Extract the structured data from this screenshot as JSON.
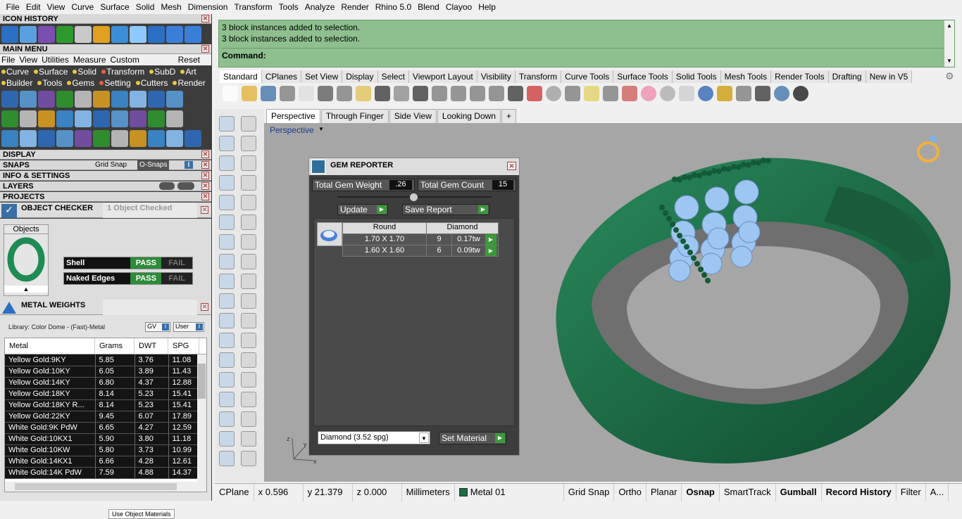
{
  "menu": [
    "File",
    "Edit",
    "View",
    "Curve",
    "Surface",
    "Solid",
    "Mesh",
    "Dimension",
    "Transform",
    "Tools",
    "Analyze",
    "Render",
    "Rhino 5.0",
    "Blend",
    "Clayoo",
    "Help"
  ],
  "left": {
    "icon_history": "ICON HISTORY",
    "main_menu": "MAIN MENU",
    "main_menu_items": [
      "File",
      "View",
      "Utilities",
      "Measure",
      "Custom"
    ],
    "reset": "Reset",
    "sub1": [
      "Curve",
      "Surface",
      "Solid",
      "Transform",
      "SubD",
      "Art"
    ],
    "sub2": [
      "Builder",
      "Tools",
      "Gems",
      "Setting",
      "Cutters",
      "Render"
    ],
    "display": "DISPLAY",
    "snaps": "SNAPS",
    "grid_snap": "Grid Snap",
    "osnaps": "O-Snaps",
    "info": "INFO & SETTINGS",
    "layers": "LAYERS",
    "projects": "PROJECTS",
    "object_checker": "OBJECT CHECKER",
    "objects_checked": "1  Object Checked",
    "objects_label": "Objects",
    "checks": [
      {
        "label": "Shell",
        "pass": "PASS",
        "fail": "FAIL"
      },
      {
        "label": "Naked Edges",
        "pass": "PASS",
        "fail": "FAIL"
      }
    ],
    "metal_weights": "METAL WEIGHTS",
    "library": "Library: Color Dome - (Fast)-Metal",
    "gv": "GV",
    "user": "User",
    "columns": [
      "Metal",
      "Grams",
      "DWT",
      "SPG"
    ],
    "rows": [
      [
        "Yellow Gold:9KY",
        "5.85",
        "3.76",
        "11.08"
      ],
      [
        "Yellow Gold:10KY",
        "6.05",
        "3.89",
        "11.43"
      ],
      [
        "Yellow Gold:14KY",
        "6.80",
        "4.37",
        "12.88"
      ],
      [
        "Yellow Gold:18KY",
        "8.14",
        "5.23",
        "15.41"
      ],
      [
        "Yellow Gold:18KY R...",
        "8.14",
        "5.23",
        "15.41"
      ],
      [
        "Yellow Gold:22KY",
        "9.45",
        "6.07",
        "17.89"
      ],
      [
        "White Gold:9K PdW",
        "6.65",
        "4.27",
        "12.59"
      ],
      [
        "White Gold:10KX1",
        "5.90",
        "3.80",
        "11.18"
      ],
      [
        "White Gold:10KW",
        "5.80",
        "3.73",
        "10.99"
      ],
      [
        "White Gold:14KX1",
        "6.66",
        "4.28",
        "12.61"
      ],
      [
        "White Gold:14K PdW",
        "7.59",
        "4.88",
        "14.37"
      ]
    ],
    "use_materials": "Use Object Materials"
  },
  "command": {
    "lines": [
      "3 block instances added to selection.",
      "3 block instances added to selection."
    ],
    "prompt": "Command:"
  },
  "tabs": [
    "Standard",
    "CPlanes",
    "Set View",
    "Display",
    "Select",
    "Viewport Layout",
    "Visibility",
    "Transform",
    "Curve Tools",
    "Surface Tools",
    "Solid Tools",
    "Mesh Tools",
    "Render Tools",
    "Drafting",
    "New in V5"
  ],
  "viewport_tabs": [
    "Perspective",
    "Through Finger",
    "Side View",
    "Looking Down",
    "+"
  ],
  "viewport_label": "Perspective",
  "gem_reporter": {
    "title": "GEM REPORTER",
    "weight_label": "Total Gem Weight",
    "weight": ".26",
    "count_label": "Total Gem Count",
    "count": "15",
    "update": "Update",
    "save": "Save Report",
    "shape": "Round",
    "material": "Diamond",
    "rows": [
      {
        "size": "1.70 X 1.70",
        "qty": "9",
        "tw": "0.17tw"
      },
      {
        "size": "1.60 X 1.60",
        "qty": "6",
        "tw": "0.09tw"
      }
    ],
    "dropdown": "Diamond     (3.52 spg)",
    "set_material": "Set Material"
  },
  "status": {
    "cplane": "CPlane",
    "x": "x 0.596",
    "y": "y 21.379",
    "z": "z 0.000",
    "units": "Millimeters",
    "layer": "Metal 01",
    "toggles": [
      "Grid Snap",
      "Ortho",
      "Planar",
      "Osnap",
      "SmartTrack",
      "Gumball",
      "Record History",
      "Filter",
      "A..."
    ]
  },
  "colors": {
    "ring": "#1e6b45",
    "gem": "#9ec6f2",
    "command_bg": "#8fbf8f",
    "pass": "#2e8b3a"
  }
}
